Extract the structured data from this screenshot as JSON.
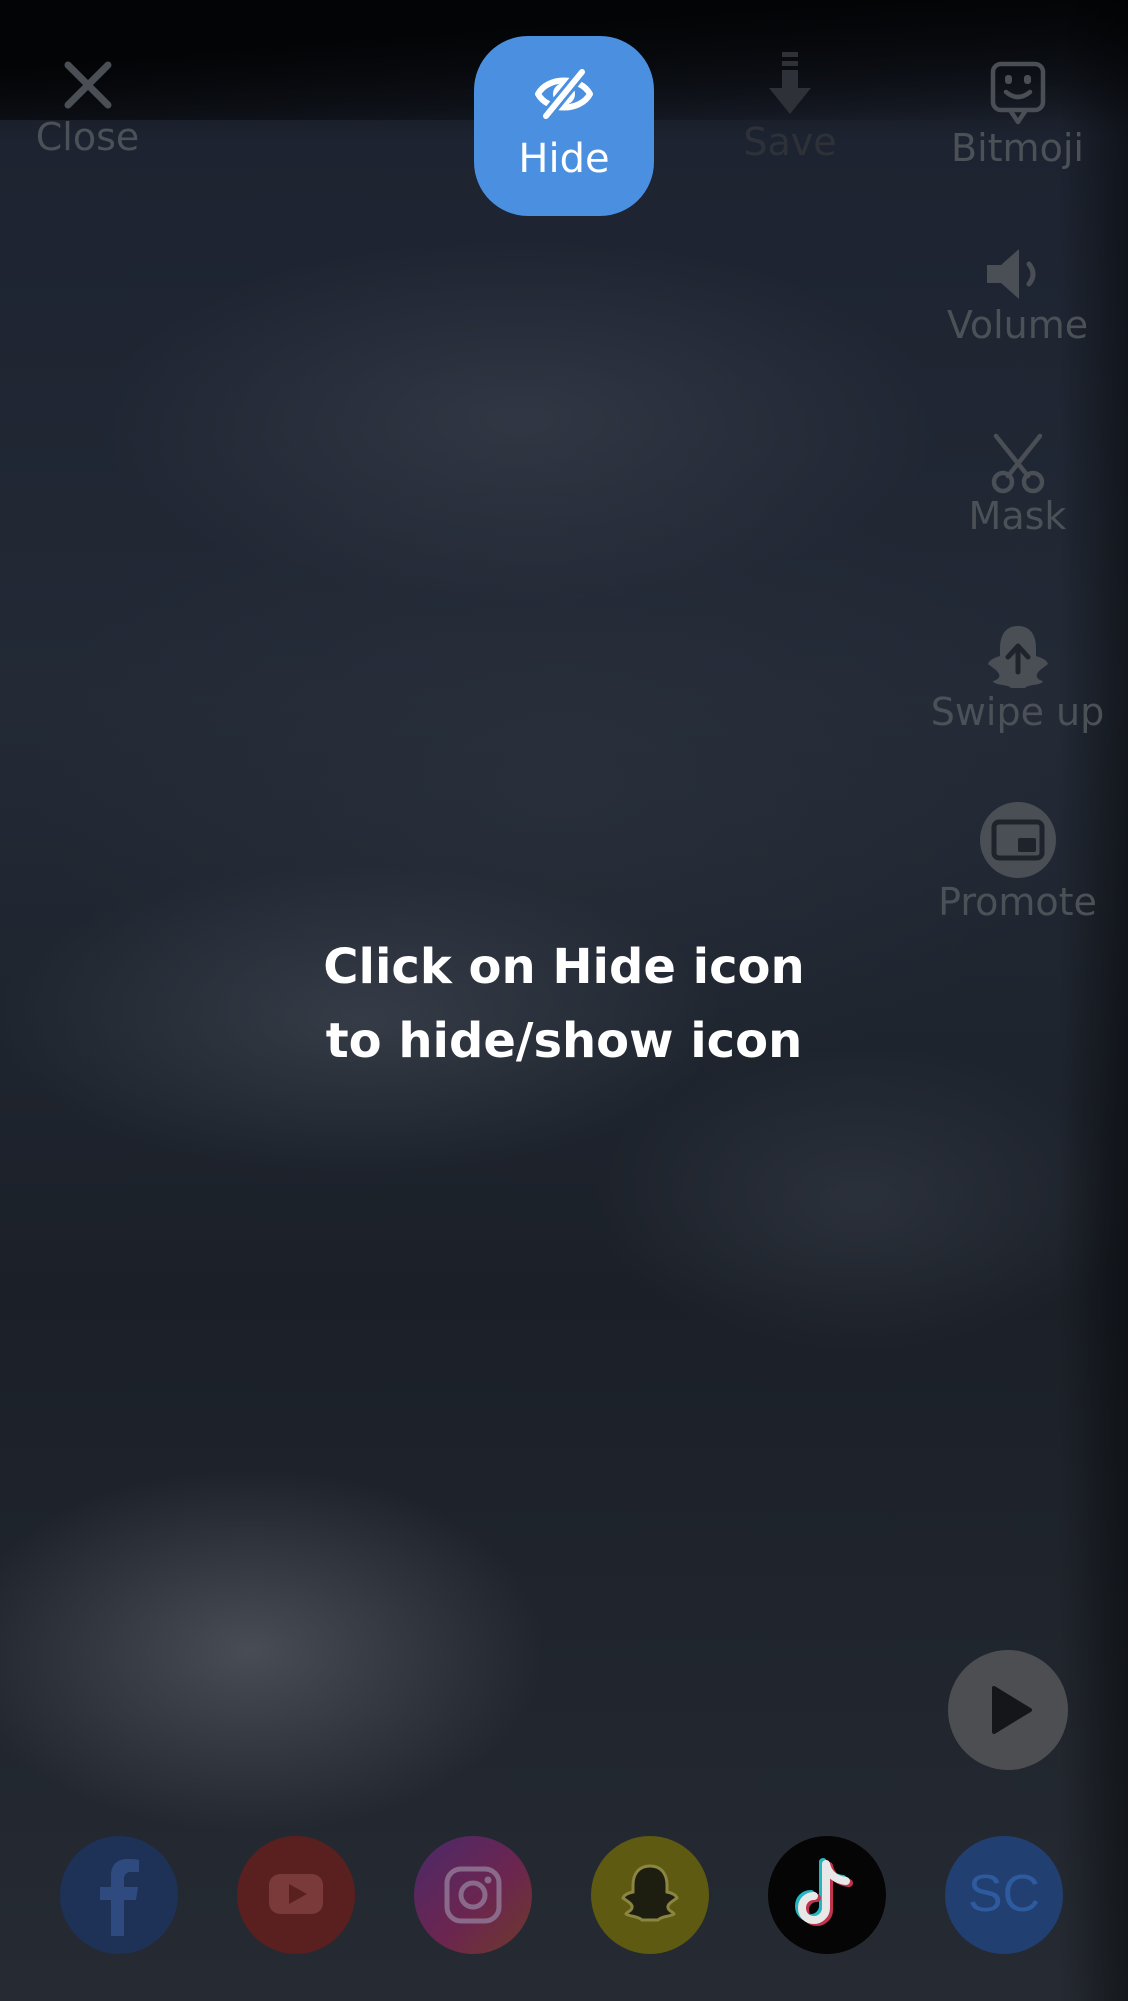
{
  "top_bar": {
    "close_label": "Close",
    "hide_label": "Hide",
    "save_label": "Save"
  },
  "side_menu": {
    "bitmoji_label": "Bitmoji",
    "volume_label": "Volume",
    "mask_label": "Mask",
    "swipe_up_label": "Swipe up",
    "promote_label": "Promote"
  },
  "hint": {
    "line1": "Click on Hide icon",
    "line2": "to hide/show icon"
  },
  "share_bar": {
    "items": [
      "facebook",
      "youtube",
      "instagram",
      "snapchat",
      "tiktok",
      "soundcloud"
    ],
    "soundcloud_text": "SC"
  },
  "colors": {
    "accent": "#4a8fe0",
    "hint_text": "#ffffff"
  }
}
